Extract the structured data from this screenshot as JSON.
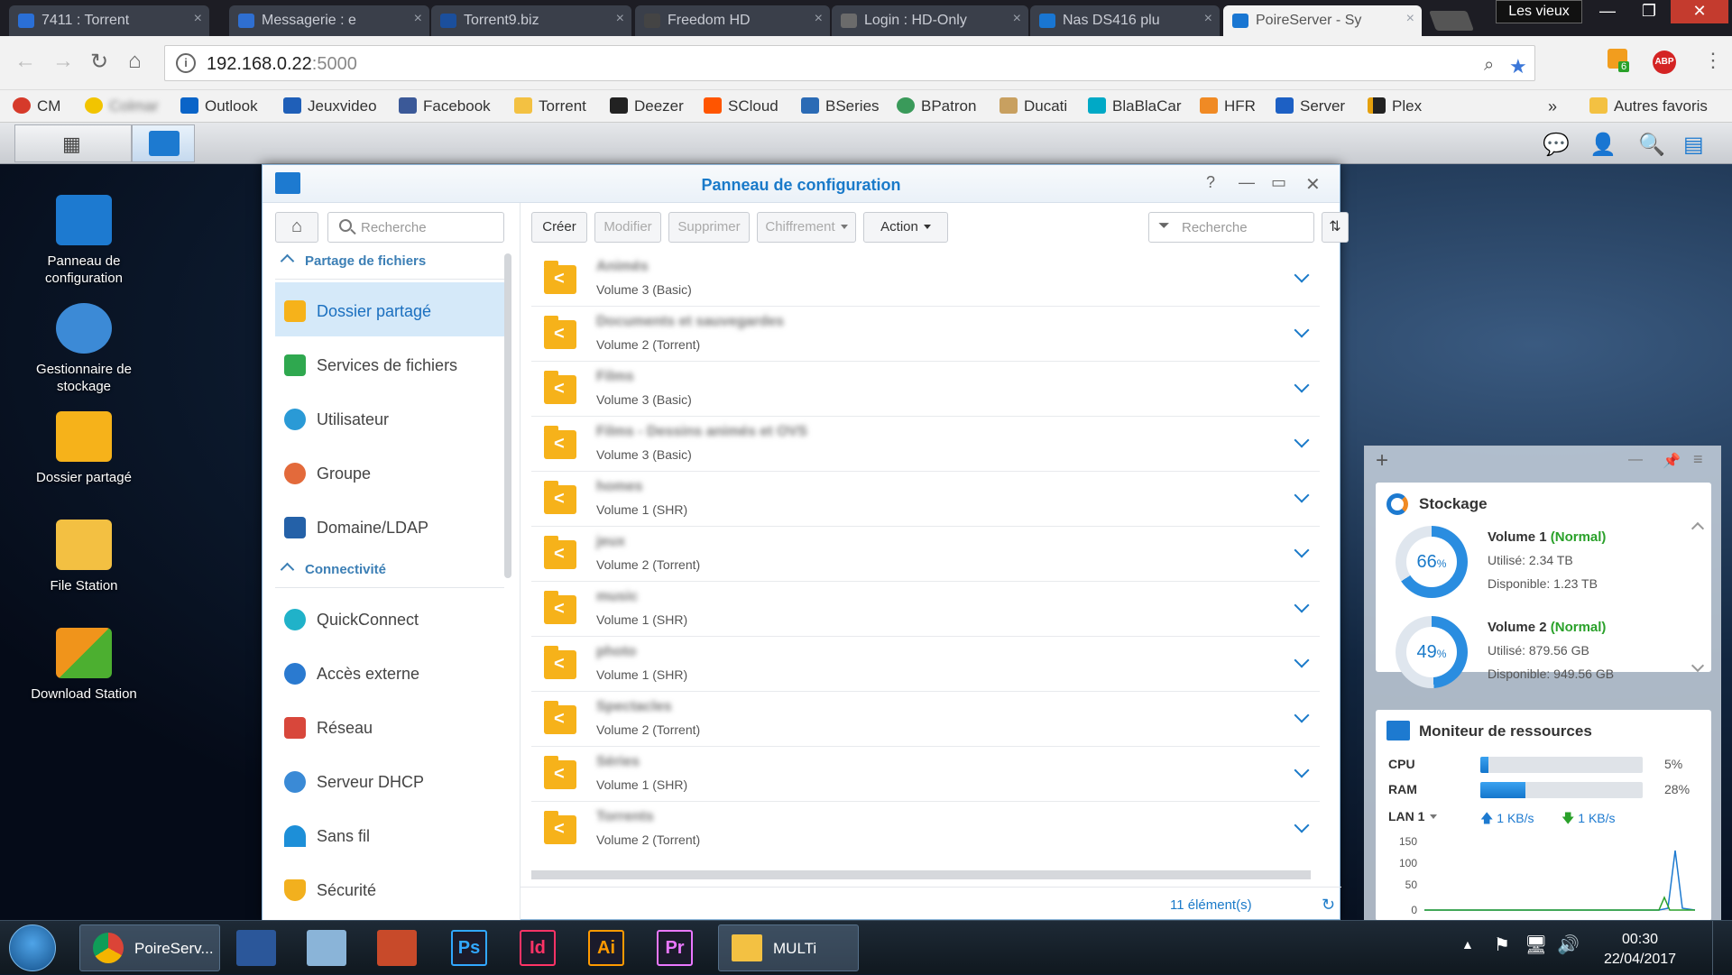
{
  "browser": {
    "tabs": [
      {
        "label": "7411 : Torrent",
        "color": "#2a6fd6"
      },
      {
        "label": "Messagerie : e",
        "color": "#2f6fd1"
      },
      {
        "label": "Torrent9.biz",
        "color": "#1b4f9c"
      },
      {
        "label": "Freedom HD",
        "color": "#444444"
      },
      {
        "label": "Login : HD-Only",
        "color": "#6b6b6b"
      },
      {
        "label": "Nas DS416 plu",
        "color": "#1976d2"
      },
      {
        "label": "PoireServer - Sy",
        "color": "#1976d2"
      }
    ],
    "profile_label": "Les vieux",
    "url_host": "192.168.0.22",
    "url_port": ":5000",
    "extension_badge": "6",
    "abp_label": "ABP"
  },
  "bookmarks": {
    "items": [
      {
        "label": "CM",
        "color": "#d63a2a"
      },
      {
        "label": "Colmar",
        "color": "#f2c400"
      },
      {
        "label": "Outlook",
        "color": "#0a64c8"
      },
      {
        "label": "Jeuxvideo",
        "color": "#1f5fb8"
      },
      {
        "label": "Facebook",
        "color": "#3b5998"
      },
      {
        "label": "Torrent",
        "color": "#f3c142"
      },
      {
        "label": "Deezer",
        "color": "#222222"
      },
      {
        "label": "SCloud",
        "color": "#ff5500"
      },
      {
        "label": "BSeries",
        "color": "#2b6bb5"
      },
      {
        "label": "BPatron",
        "color": "#3a9a5a"
      },
      {
        "label": "Ducati",
        "color": "#c8a060"
      },
      {
        "label": "BlaBlaCar",
        "color": "#00a9c6"
      },
      {
        "label": "HFR",
        "color": "#f08a24"
      },
      {
        "label": "Server",
        "color": "#1d60c4"
      },
      {
        "label": "Plex",
        "color": "#e5a00d"
      }
    ],
    "overflow": "»",
    "other": "Autres favoris"
  },
  "desktop": {
    "icons": [
      {
        "label": "Panneau de configuration",
        "color": "#1d7ad0"
      },
      {
        "label": "Gestionnaire de stockage",
        "color": "#3c8ad6"
      },
      {
        "label": "Dossier partagé",
        "color": "#f6b21a"
      },
      {
        "label": "File Station",
        "color": "#f3c042"
      },
      {
        "label": "Download Station",
        "color": "#f0941b"
      }
    ]
  },
  "window": {
    "title": "Panneau de configuration",
    "sidebar_search_placeholder": "Recherche",
    "sections": [
      {
        "label": "Partage de fichiers"
      },
      {
        "label": "Connectivité"
      }
    ],
    "nav": [
      {
        "label": "Dossier partagé",
        "color": "#f6b21a",
        "active": true
      },
      {
        "label": "Services de fichiers",
        "color": "#2fa84f"
      },
      {
        "label": "Utilisateur",
        "color": "#2a9ad6"
      },
      {
        "label": "Groupe",
        "color": "#e36a3b"
      },
      {
        "label": "Domaine/LDAP",
        "color": "#2461a8"
      },
      {
        "label": "QuickConnect",
        "color": "#20b2c9"
      },
      {
        "label": "Accès externe",
        "color": "#2a7ad0"
      },
      {
        "label": "Réseau",
        "color": "#d8473b"
      },
      {
        "label": "Serveur DHCP",
        "color": "#3a8ad6"
      },
      {
        "label": "Sans fil",
        "color": "#1d8fd8"
      },
      {
        "label": "Sécurité",
        "color": "#f2b01e"
      }
    ],
    "toolbar": {
      "create": "Créer",
      "modify": "Modifier",
      "delete": "Supprimer",
      "encrypt": "Chiffrement",
      "action": "Action",
      "search_placeholder": "Recherche"
    },
    "folders": [
      {
        "name": "Animés",
        "volume": "Volume 3 (Basic)"
      },
      {
        "name": "Documents et sauvegardes",
        "volume": "Volume 2 (Torrent)"
      },
      {
        "name": "Films",
        "volume": "Volume 3 (Basic)"
      },
      {
        "name": "Films - Dessins animés et OVS",
        "volume": "Volume 3 (Basic)"
      },
      {
        "name": "homes",
        "volume": "Volume 1 (SHR)"
      },
      {
        "name": "jeux",
        "volume": "Volume 2 (Torrent)"
      },
      {
        "name": "music",
        "volume": "Volume 1 (SHR)"
      },
      {
        "name": "photo",
        "volume": "Volume 1 (SHR)"
      },
      {
        "name": "Spectacles",
        "volume": "Volume 2 (Torrent)"
      },
      {
        "name": "Séries",
        "volume": "Volume 1 (SHR)"
      },
      {
        "name": "Torrents",
        "volume": "Volume 2 (Torrent)"
      }
    ],
    "count_label": "11 élément(s)"
  },
  "widgets": {
    "storage": {
      "title": "Stockage",
      "volumes": [
        {
          "name": "Volume 1",
          "status": "(Normal)",
          "percent": 66,
          "pct_label": "66",
          "used": "Utilisé: 2.34 TB",
          "free": "Disponible: 1.23 TB"
        },
        {
          "name": "Volume 2",
          "status": "(Normal)",
          "percent": 49,
          "pct_label": "49",
          "used": "Utilisé: 879.56 GB",
          "free": "Disponible: 949.56 GB"
        }
      ],
      "pct_suffix": "%"
    },
    "monitor": {
      "title": "Moniteur de ressources",
      "cpu_label": "CPU",
      "cpu_value": 5,
      "cpu_text": "5%",
      "ram_label": "RAM",
      "ram_value": 28,
      "ram_text": "28%",
      "lan_label": "LAN 1",
      "up": "1 KB/s",
      "down": "1 KB/s",
      "yticks": [
        "150",
        "100",
        "50",
        "0"
      ]
    }
  },
  "taskbar": {
    "chrome_label": "PoireServ...",
    "folder_label": "MULTi",
    "apps": [
      {
        "label": "Ps",
        "color": "#31a8ff"
      },
      {
        "label": "Id",
        "color": "#ff3366"
      },
      {
        "label": "Ai",
        "color": "#ff9a00"
      },
      {
        "label": "Pr",
        "color": "#ea77ff"
      }
    ],
    "time": "00:30",
    "date": "22/04/2017"
  }
}
